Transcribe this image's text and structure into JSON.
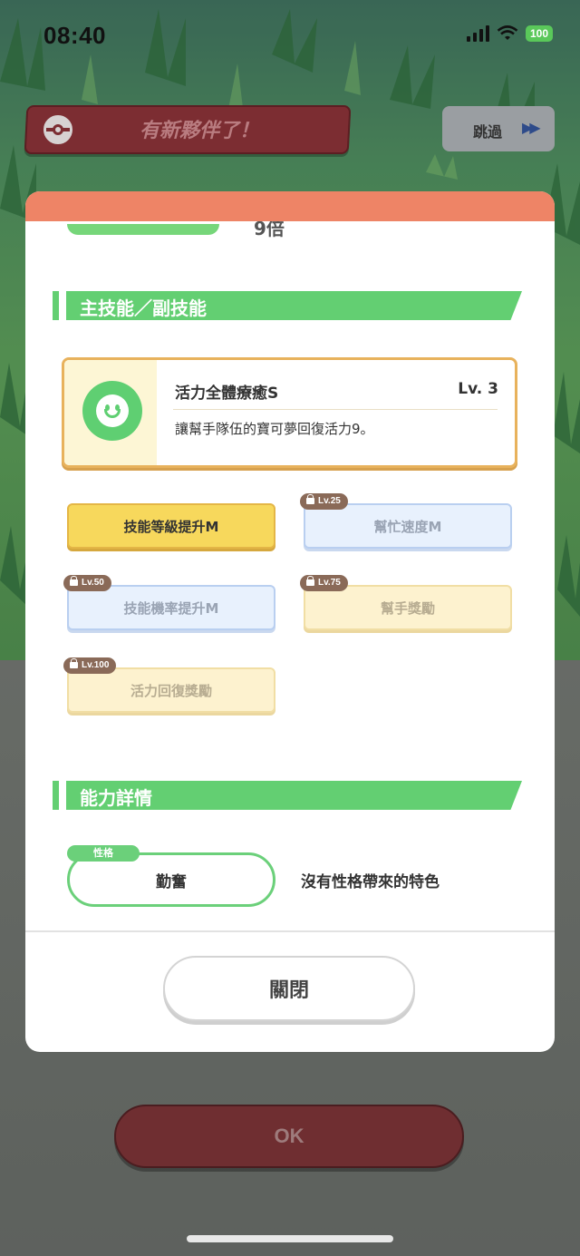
{
  "status_bar": {
    "time": "08:40",
    "battery": "100"
  },
  "header": {
    "title": "有新夥伴了！",
    "skip_label": "跳過",
    "skip_icon": "fast-forward-icon"
  },
  "modal": {
    "partial_value": "9倍",
    "main_skill_section": {
      "title": "主技能／副技能",
      "main_skill": {
        "name": "活力全體療癒S",
        "level": "Lv. 3",
        "description": "讓幫手隊伍的寶可夢回復活力9。",
        "icon": "smile-icon"
      },
      "sub_skills": [
        {
          "label": "技能等級提升M",
          "locked": false,
          "unlock_level": ""
        },
        {
          "label": "幫忙速度M",
          "locked": true,
          "unlock_level": "Lv.25"
        },
        {
          "label": "技能機率提升M",
          "locked": true,
          "unlock_level": "Lv.50"
        },
        {
          "label": "幫手獎勵",
          "locked": true,
          "unlock_level": "Lv.75"
        },
        {
          "label": "活力回復獎勵",
          "locked": true,
          "unlock_level": "Lv.100"
        }
      ]
    },
    "ability_section": {
      "title": "能力詳情",
      "nature_tag": "性格",
      "nature": "勤奮",
      "nature_effect": "沒有性格帶來的特色"
    },
    "close_label": "關閉"
  },
  "ok_label": "OK",
  "colors": {
    "accent_green": "#63cf72",
    "modal_top": "#ee8466",
    "header_red": "#7c2d32",
    "skill_gold": "#f7d85c"
  }
}
